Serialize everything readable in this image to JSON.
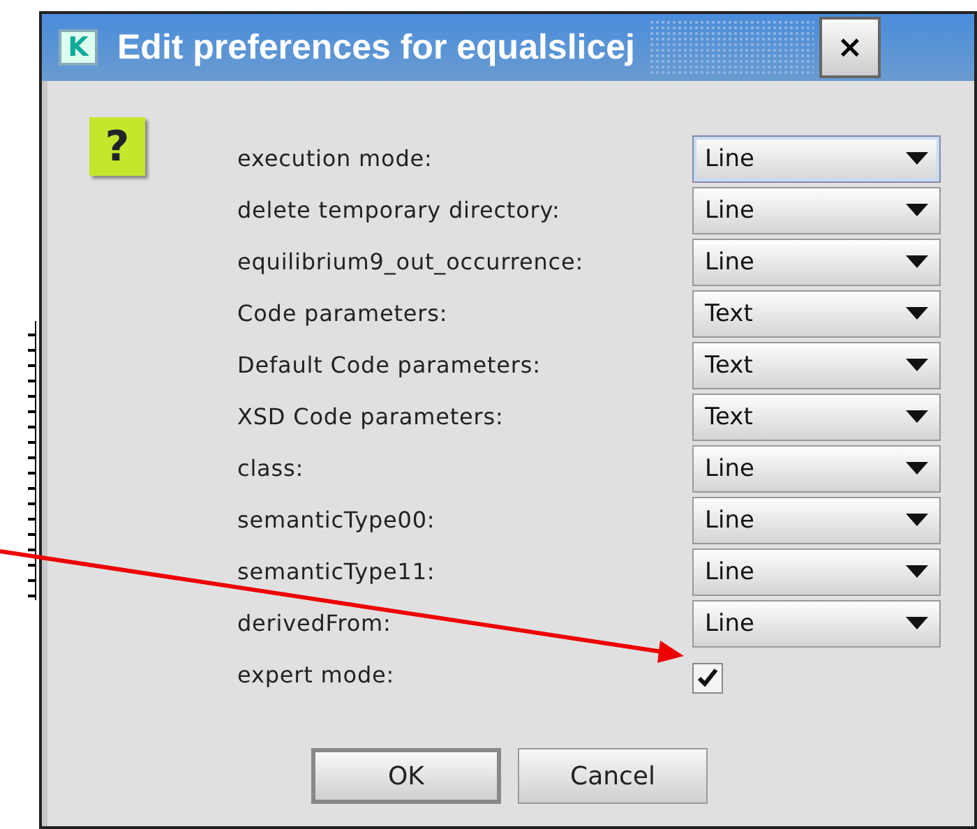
{
  "window": {
    "title": "Edit preferences for equalslicej",
    "app_icon": "K",
    "close": "×"
  },
  "help_icon": "?",
  "fields": [
    {
      "kind": "combo",
      "label": "execution mode:",
      "value": "Line",
      "focused": true
    },
    {
      "kind": "combo",
      "label": "delete temporary directory:",
      "value": "Line",
      "focused": false
    },
    {
      "kind": "combo",
      "label": "equilibrium9_out_occurrence:",
      "value": "Line",
      "focused": false
    },
    {
      "kind": "combo",
      "label": "Code parameters:",
      "value": "Text",
      "focused": false
    },
    {
      "kind": "combo",
      "label": "Default Code parameters:",
      "value": "Text",
      "focused": false
    },
    {
      "kind": "combo",
      "label": "XSD Code parameters:",
      "value": "Text",
      "focused": false
    },
    {
      "kind": "combo",
      "label": "class:",
      "value": "Line",
      "focused": false
    },
    {
      "kind": "combo",
      "label": "semanticType00:",
      "value": "Line",
      "focused": false
    },
    {
      "kind": "combo",
      "label": "semanticType11:",
      "value": "Line",
      "focused": false
    },
    {
      "kind": "combo",
      "label": "derivedFrom:",
      "value": "Line",
      "focused": false
    },
    {
      "kind": "checkbox",
      "label": "expert mode:",
      "checked": true
    }
  ],
  "buttons": [
    {
      "label": "OK",
      "default": true
    },
    {
      "label": "Cancel",
      "default": false
    }
  ]
}
